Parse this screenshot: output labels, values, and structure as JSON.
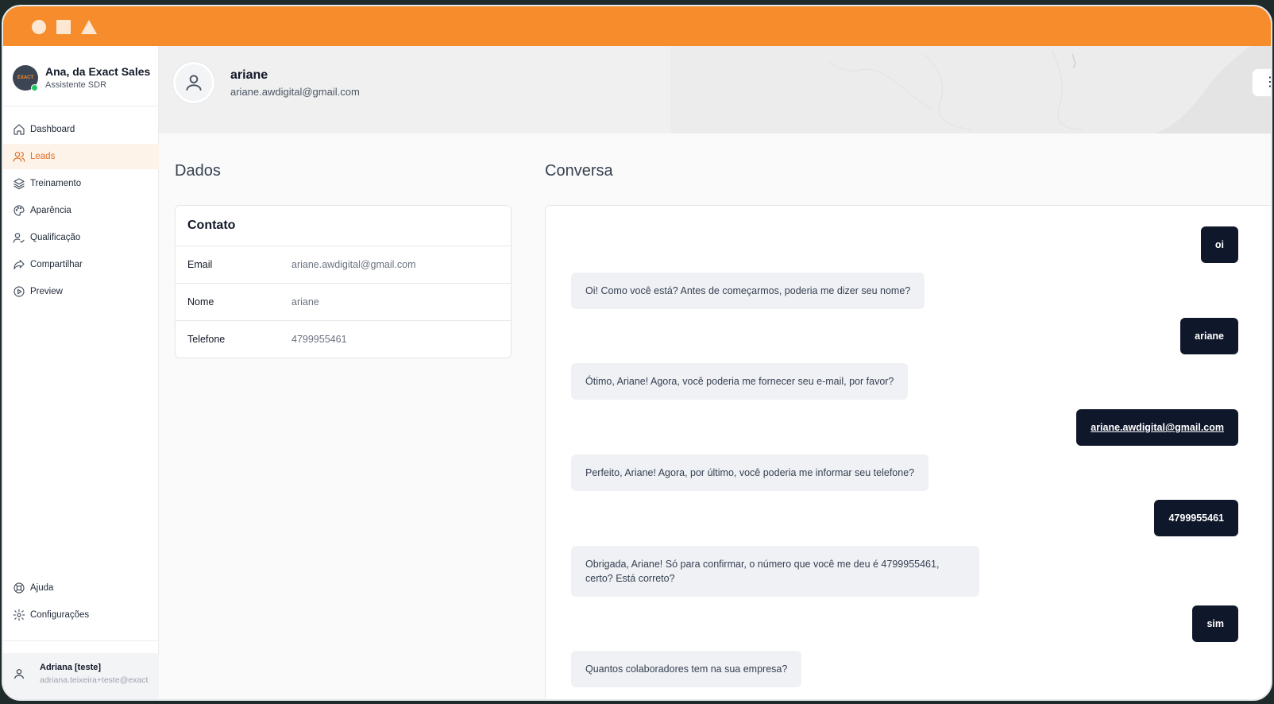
{
  "brand": {
    "name": "Ana, da Exact Sales",
    "role": "Assistente SDR",
    "logo_text": "EXACT"
  },
  "nav": {
    "items": [
      {
        "label": "Dashboard",
        "icon": "home-icon",
        "active": false
      },
      {
        "label": "Leads",
        "icon": "users-icon",
        "active": true
      },
      {
        "label": "Treinamento",
        "icon": "layers-icon",
        "active": false
      },
      {
        "label": "Aparência",
        "icon": "palette-icon",
        "active": false
      },
      {
        "label": "Qualificação",
        "icon": "user-check-icon",
        "active": false
      },
      {
        "label": "Compartilhar",
        "icon": "share-icon",
        "active": false
      },
      {
        "label": "Preview",
        "icon": "play-circle-icon",
        "active": false
      }
    ],
    "bottom_items": [
      {
        "label": "Ajuda",
        "icon": "lifebuoy-icon"
      },
      {
        "label": "Configurações",
        "icon": "gear-icon"
      }
    ]
  },
  "user": {
    "name": "Adriana [teste]",
    "email": "adriana.teixeira+teste@exact"
  },
  "lead": {
    "name": "ariane",
    "email": "ariane.awdigital@gmail.com"
  },
  "dados": {
    "title": "Dados",
    "card_title": "Contato",
    "fields": [
      {
        "label": "Email",
        "value": "ariane.awdigital@gmail.com"
      },
      {
        "label": "Nome",
        "value": "ariane"
      },
      {
        "label": "Telefone",
        "value": "4799955461"
      }
    ]
  },
  "conversa": {
    "title": "Conversa",
    "messages": [
      {
        "from": "user",
        "text": "oi"
      },
      {
        "from": "bot",
        "text": "Oi! Como você está? Antes de começarmos, poderia me dizer seu nome?"
      },
      {
        "from": "user",
        "text": "ariane"
      },
      {
        "from": "bot",
        "text": "Ótimo, Ariane! Agora, você poderia me fornecer seu e-mail, por favor?"
      },
      {
        "from": "user",
        "text": "ariane.awdigital@gmail.com"
      },
      {
        "from": "bot",
        "text": "Perfeito, Ariane! Agora, por último, você poderia me informar seu telefone?"
      },
      {
        "from": "user",
        "text": "4799955461"
      },
      {
        "from": "bot",
        "text": "Obrigada, Ariane! Só para confirmar, o número que você me deu é 4799955461, certo? Está correto?"
      },
      {
        "from": "user",
        "text": "sim"
      },
      {
        "from": "bot",
        "text": "Quantos colaboradores tem na sua empresa?"
      }
    ]
  },
  "colors": {
    "accent": "#f68c2b",
    "active_nav_bg": "#fef3e8",
    "active_nav_text": "#e0702a",
    "user_bubble": "#0f172a",
    "bot_bubble": "#eff1f5",
    "online": "#22c55e"
  }
}
